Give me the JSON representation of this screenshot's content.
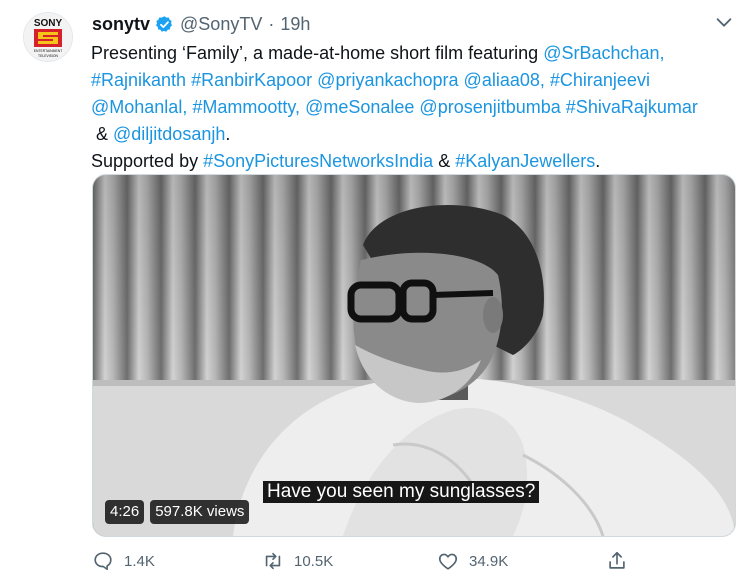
{
  "account": {
    "display_name": "sonytv",
    "handle": "@SonyTV",
    "separator": "·",
    "time": "19h",
    "avatar_text": [
      "SONY",
      "ENTERTAINMENT",
      "TELEVISION"
    ]
  },
  "tweet": {
    "line1_plain": "Presenting ‘Family’, a made-at-home short film featuring ",
    "line1_link": "@SrBachchan,",
    "line2": [
      "#Rajnikanth",
      "#RanbirKapoor",
      "@priyankachopra",
      "@aliaa08,",
      "#Chiranjeevi"
    ],
    "line3": [
      "@Mohanlal,",
      "#Mammootty,",
      "@meSonalee",
      "@prosenjitbumba",
      "#ShivaRajkumar"
    ],
    "line4_amp": " & ",
    "line4_link": "@diljitdosanjh",
    "line4_end": ".",
    "line5_plain": "Supported by ",
    "line5_link1": "#SonyPicturesNetworksIndia",
    "line5_amp": " & ",
    "line5_link2": "#KalyanJewellers",
    "line5_end": "."
  },
  "video": {
    "subtitle": "Have you seen my sunglasses?",
    "duration": "4:26",
    "views": "597.8K views"
  },
  "actions": {
    "replies": "1.4K",
    "retweets": "10.5K",
    "likes": "34.9K"
  },
  "colors": {
    "link": "#1b95e0",
    "verified": "#1da1f2",
    "sony_red": "#d6202a",
    "sony_yellow": "#f6c419"
  }
}
